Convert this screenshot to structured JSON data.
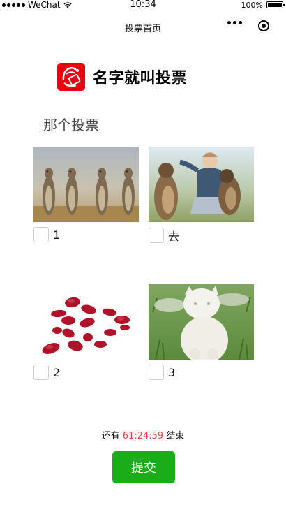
{
  "status_bar": {
    "carrier": "WeChat",
    "time": "10:34",
    "battery": "100%"
  },
  "nav": {
    "title": "投票首页"
  },
  "brand": {
    "name": "名字就叫投票"
  },
  "vote": {
    "title": "那个投票",
    "options": [
      {
        "label": "1",
        "image": "meerkats-photo",
        "checked": false
      },
      {
        "label": "去",
        "image": "boy-with-marmots-photo",
        "checked": false
      },
      {
        "label": "2",
        "image": "rose-petals-photo",
        "checked": false
      },
      {
        "label": "3",
        "image": "white-cat-photo",
        "checked": false
      }
    ]
  },
  "countdown": {
    "prefix": "还有",
    "time": "61:24:59",
    "suffix": "结束"
  },
  "submit_label": "提交",
  "colors": {
    "submit_green": "#1aad19",
    "countdown_red": "#e64340",
    "brand_red": "#e60012"
  }
}
